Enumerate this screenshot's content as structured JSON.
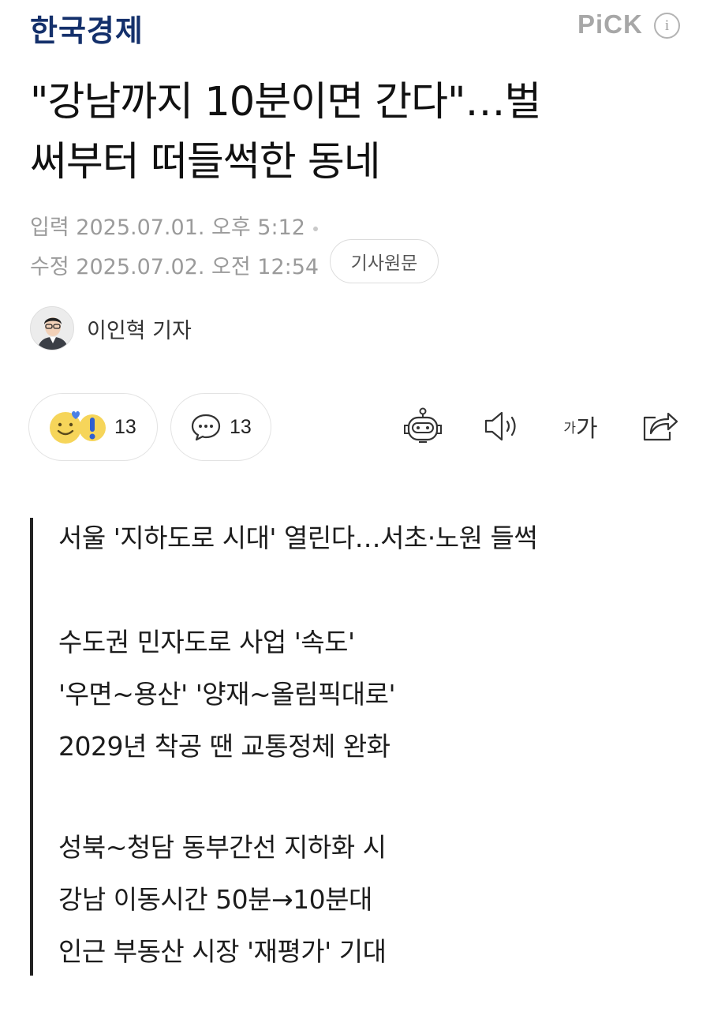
{
  "header": {
    "press_name": "한국경제",
    "pick_label": "PiCK",
    "info_label": "i"
  },
  "article": {
    "title_line1": "\"강남까지 10분이면 간다\"…벌",
    "title_line2": "써부터 떠들썩한 동네",
    "input_label": "입력",
    "input_datetime": "2025.07.01. 오후 5:12",
    "modified_label": "수정",
    "modified_datetime": "2025.07.02. 오전 12:54",
    "original_button": "기사원문",
    "reporter_name": "이인혁 기자"
  },
  "engagement": {
    "reaction_count": "13",
    "comment_count": "13",
    "font_small": "가",
    "font_large": "가"
  },
  "summary": {
    "headline": "서울 '지하도로 시대' 열린다…서초·노원 들썩",
    "para1": [
      "수도권 민자도로 사업 '속도'",
      "'우면~용산' '양재~올림픽대로'",
      "2029년 착공 땐 교통정체 완화"
    ],
    "para2": [
      "성북~청담 동부간선 지하화 시",
      "강남 이동시간 50분→10분대",
      "인근 부동산 시장 '재평가' 기대"
    ]
  },
  "colors": {
    "press_logo": "#14306b",
    "meta_text": "#9b9b9b",
    "summary_bar": "#222222",
    "reaction_yellow": "#f6d55a",
    "reaction_blue": "#4a7fe6"
  },
  "icons": [
    "info-icon",
    "avatar",
    "smile-emoji-icon",
    "exclamation-emoji-icon",
    "comment-icon",
    "robot-summary-icon",
    "speaker-icon",
    "font-size-icon",
    "share-icon"
  ]
}
